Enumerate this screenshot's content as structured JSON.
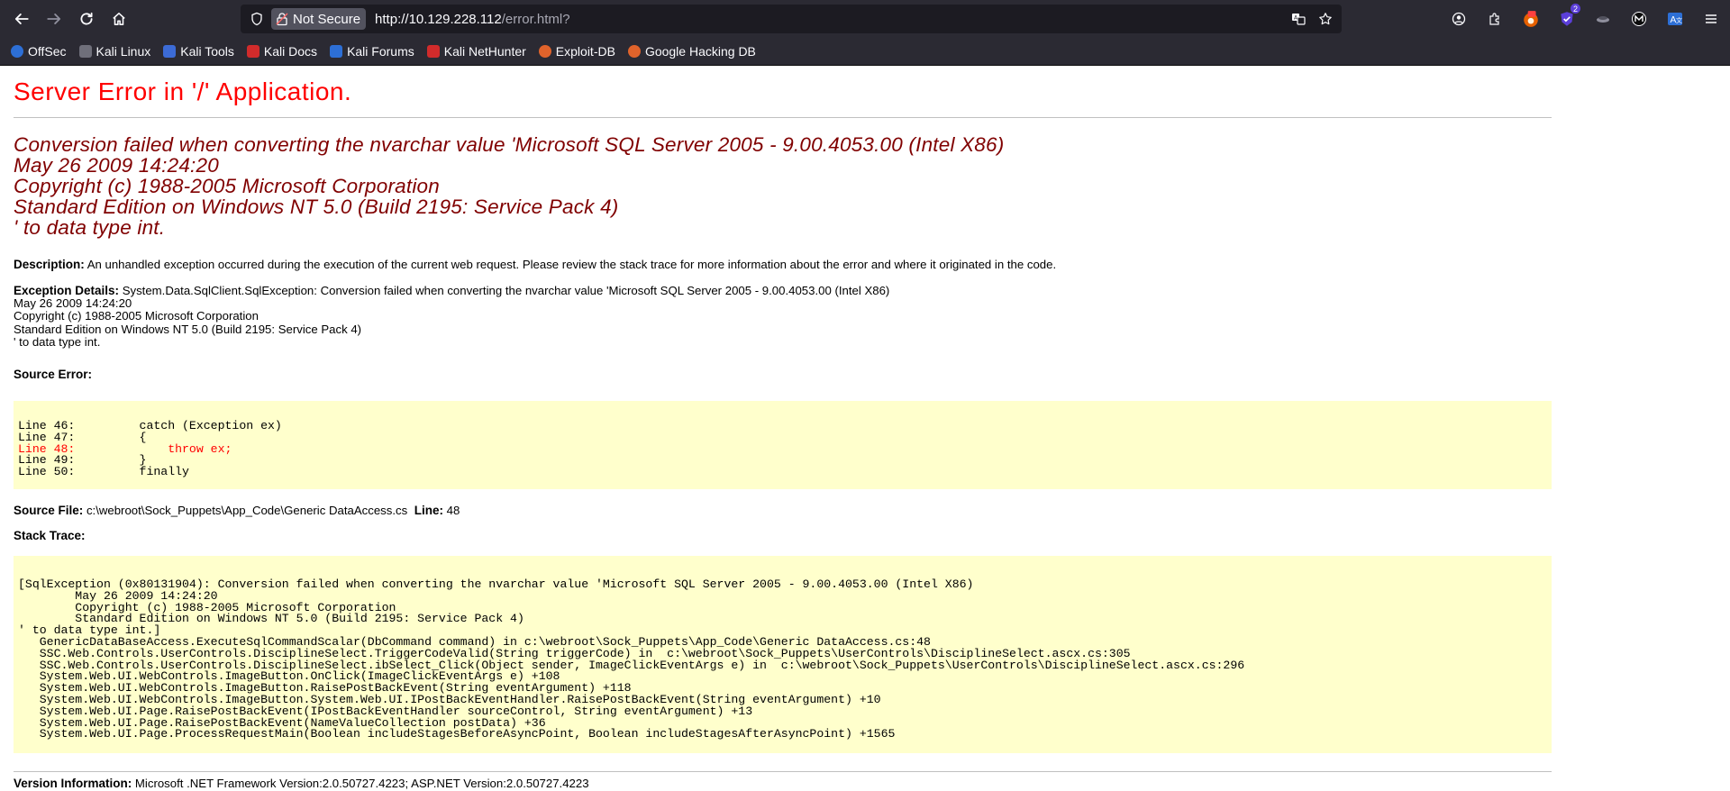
{
  "browser": {
    "security_label": "Not Secure",
    "url_host": "http://10.129.228.112",
    "url_path": "/error.html?",
    "extension_badge": "2",
    "bookmarks": [
      {
        "label": "OffSec",
        "color": "#2d6fd6"
      },
      {
        "label": "Kali Linux",
        "color": "#4b4b55"
      },
      {
        "label": "Kali Tools",
        "color": "#3c6bd6"
      },
      {
        "label": "Kali Docs",
        "color": "#d12b2b"
      },
      {
        "label": "Kali Forums",
        "color": "#2d6fd6"
      },
      {
        "label": "Kali NetHunter",
        "color": "#d12b2b"
      },
      {
        "label": "Exploit-DB",
        "color": "#e0632b"
      },
      {
        "label": "Google Hacking DB",
        "color": "#e0632b"
      }
    ]
  },
  "page": {
    "title": "Server Error in '/' Application.",
    "error_lines": [
      "Conversion failed when converting the nvarchar value 'Microsoft SQL Server 2005 - 9.00.4053.00 (Intel X86)",
      "May 26 2009 14:24:20",
      "Copyright (c) 1988-2005 Microsoft Corporation",
      "Standard Edition on Windows NT 5.0 (Build 2195: Service Pack 4)",
      "' to data type int."
    ],
    "description_label": "Description:",
    "description_text": " An unhandled exception occurred during the execution of the current web request. Please review the stack trace for more information about the error and where it originated in the code.",
    "exception_label": "Exception Details:",
    "exception_first": " System.Data.SqlClient.SqlException: Conversion failed when converting the nvarchar value 'Microsoft SQL Server 2005 - 9.00.4053.00 (Intel X86)",
    "exception_lines": [
      "May 26 2009 14:24:20",
      "Copyright (c) 1988-2005 Microsoft Corporation",
      "Standard Edition on Windows NT 5.0 (Build 2195: Service Pack 4)",
      "' to data type int."
    ],
    "source_error_label": "Source Error:",
    "source_lines": [
      {
        "text": "Line 46:         catch (Exception ex)",
        "highlight": false
      },
      {
        "text": "Line 47:         {",
        "highlight": false
      },
      {
        "text": "Line 48:             throw ex;",
        "highlight": true
      },
      {
        "text": "Line 49:         }",
        "highlight": false
      },
      {
        "text": "Line 50:         finally",
        "highlight": false
      }
    ],
    "source_file_label": "Source File:",
    "source_file_value": " c:\\webroot\\Sock_Puppets\\App_Code\\Generic DataAccess.cs",
    "line_label": "  Line:",
    "line_value": " 48",
    "stack_label": "Stack Trace:",
    "stack_lines": [
      "[SqlException (0x80131904): Conversion failed when converting the nvarchar value 'Microsoft SQL Server 2005 - 9.00.4053.00 (Intel X86)",
      "        May 26 2009 14:24:20",
      "        Copyright (c) 1988-2005 Microsoft Corporation",
      "        Standard Edition on Windows NT 5.0 (Build 2195: Service Pack 4)",
      "' to data type int.]",
      "   GenericDataBaseAccess.ExecuteSqlCommandScalar(DbCommand command) in c:\\webroot\\Sock_Puppets\\App_Code\\Generic DataAccess.cs:48",
      "   SSC.Web.Controls.UserControls.DisciplineSelect.TriggerCodeValid(String triggerCode) in  c:\\webroot\\Sock_Puppets\\UserControls\\DisciplineSelect.ascx.cs:305",
      "   SSC.Web.Controls.UserControls.DisciplineSelect.ibSelect_Click(Object sender, ImageClickEventArgs e) in  c:\\webroot\\Sock_Puppets\\UserControls\\DisciplineSelect.ascx.cs:296",
      "   System.Web.UI.WebControls.ImageButton.OnClick(ImageClickEventArgs e) +108",
      "   System.Web.UI.WebControls.ImageButton.RaisePostBackEvent(String eventArgument) +118",
      "   System.Web.UI.WebControls.ImageButton.System.Web.UI.IPostBackEventHandler.RaisePostBackEvent(String eventArgument) +10",
      "   System.Web.UI.Page.RaisePostBackEvent(IPostBackEventHandler sourceControl, String eventArgument) +13",
      "   System.Web.UI.Page.RaisePostBackEvent(NameValueCollection postData) +36",
      "   System.Web.UI.Page.ProcessRequestMain(Boolean includeStagesBeforeAsyncPoint, Boolean includeStagesAfterAsyncPoint) +1565"
    ],
    "version_label": "Version Information:",
    "version_text": " Microsoft .NET Framework Version:2.0.50727.4223; ASP.NET Version:2.0.50727.4223"
  }
}
